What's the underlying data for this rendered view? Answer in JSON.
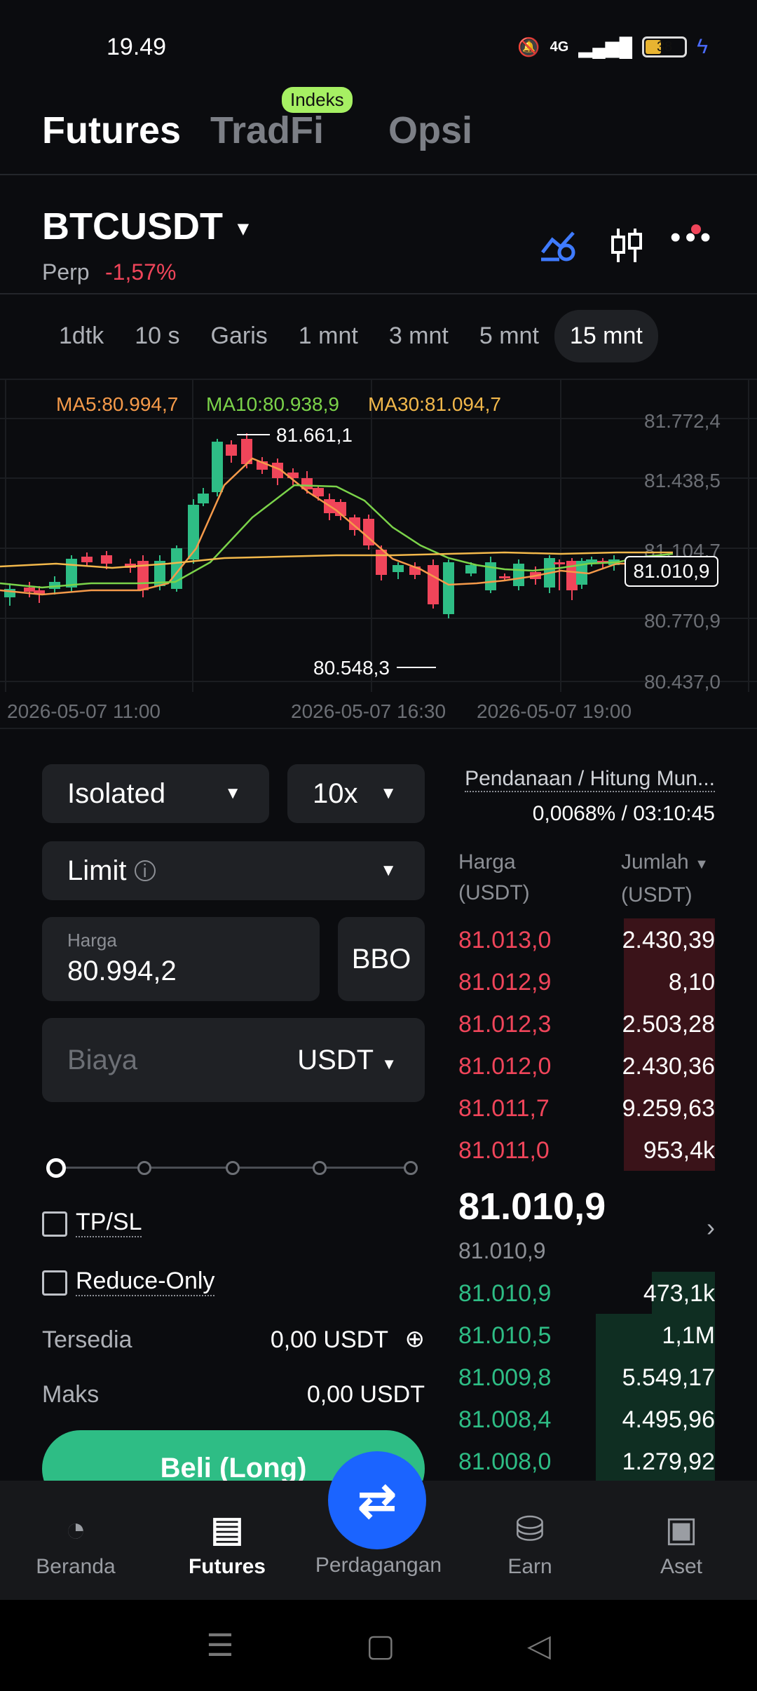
{
  "status": {
    "time": "19.49",
    "battery": "38",
    "network": "4G"
  },
  "tabs": {
    "futures": "Futures",
    "tradfi": "TradFi",
    "tradfi_badge": "Indeks",
    "opsi": "Opsi"
  },
  "symbol": {
    "name": "BTCUSDT",
    "type": "Perp",
    "change": "-1,57%"
  },
  "intervals": [
    "1dtk",
    "10 s",
    "Garis",
    "1 mnt",
    "3 mnt",
    "5 mnt",
    "15 mnt"
  ],
  "selected_interval": "15 mnt",
  "chart_data": {
    "type": "candlestick",
    "ma": {
      "ma5": "MA5:80.994,7",
      "ma10": "MA10:80.938,9",
      "ma30": "MA30:81.094,7"
    },
    "y_ticks": [
      "81.772,4",
      "81.438,5",
      "81.104,7",
      "80.770,9",
      "80.437,0"
    ],
    "x_ticks": [
      "2026-05-07 11:00",
      "2026-05-07 16:30",
      "2026-05-07 19:00"
    ],
    "high_label": "81.661,1",
    "low_label": "80.548,3",
    "last_price": "81.010,9",
    "colors": {
      "up": "#2ebd85",
      "down": "#f0455a",
      "ma5": "#f59a4a",
      "ma10": "#7bd34a",
      "ma30": "#f2b84b"
    }
  },
  "order": {
    "margin_mode": "Isolated",
    "leverage": "10x",
    "order_type": "Limit",
    "price_label": "Harga",
    "price_value": "80.994,2",
    "bbo": "BBO",
    "cost_placeholder": "Biaya",
    "cost_unit": "USDT",
    "tpsl": "TP/SL",
    "reduce_only": "Reduce-Only",
    "available_label": "Tersedia",
    "available_value": "0,00 USDT",
    "max_label": "Maks",
    "max_value": "0,00 USDT",
    "buy_button": "Beli (Long)"
  },
  "orderbook": {
    "funding_label": "Pendanaan / Hitung Mun...",
    "funding_value": "0,0068% / 03:10:45",
    "col_price": "Harga",
    "col_price_unit": "(USDT)",
    "col_qty": "Jumlah",
    "col_qty_unit": "(USDT)",
    "asks": [
      {
        "price": "81.013,0",
        "qty": "2.430,39"
      },
      {
        "price": "81.012,9",
        "qty": "8,10"
      },
      {
        "price": "81.012,3",
        "qty": "2.503,28"
      },
      {
        "price": "81.012,0",
        "qty": "2.430,36"
      },
      {
        "price": "81.011,7",
        "qty": "9.259,63"
      },
      {
        "price": "81.011,0",
        "qty": "953,4k"
      }
    ],
    "last_price": "81.010,9",
    "mark_price": "81.010,9",
    "bids": [
      {
        "price": "81.010,9",
        "qty": "473,1k"
      },
      {
        "price": "81.010,5",
        "qty": "1,1M"
      },
      {
        "price": "81.009,8",
        "qty": "5.549,17"
      },
      {
        "price": "81.008,4",
        "qty": "4.495,96"
      },
      {
        "price": "81.008,0",
        "qty": "1.279,92"
      }
    ]
  },
  "bottom_nav": {
    "home": "Beranda",
    "futures": "Futures",
    "trade": "Perdagangan",
    "earn": "Earn",
    "assets": "Aset"
  }
}
